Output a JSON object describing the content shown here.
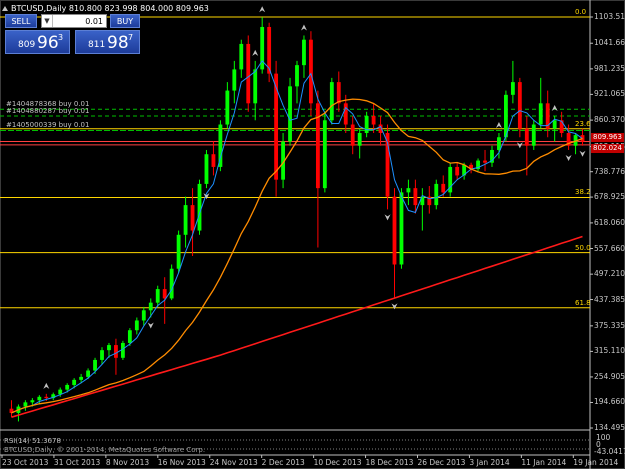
{
  "header": {
    "symbol_line": "BTCUSD,Daily  810.800 823.998 804.000 809.963"
  },
  "trade_panel": {
    "sell_label": "SELL",
    "buy_label": "BUY",
    "lot_value": "0.01",
    "sell_price_prefix": "809",
    "sell_price_big": "96",
    "sell_price_sup": "3",
    "buy_price_prefix": "811",
    "buy_price_big": "98",
    "buy_price_sup": "7"
  },
  "orders": [
    {
      "label": "#1404878368 buy 0.01",
      "price": 886
    },
    {
      "label": "#1404880287 buy 0.01",
      "price": 870
    },
    {
      "label": "#1405000339 buy 0.01",
      "price": 836
    }
  ],
  "price_axis": {
    "ticks": [
      "1103.510",
      "1041.665",
      "981.235",
      "921.065",
      "860.370",
      "798.115",
      "738.776",
      "678.925",
      "618.060",
      "557.660",
      "497.210",
      "437.385",
      "375.335",
      "315.110",
      "254.905",
      "194.660",
      "134.495"
    ],
    "current_bid": "809.963",
    "current_ask": "802.024",
    "sub_ticks": [
      "100",
      "0"
    ],
    "sub_bottom": "-43.0417"
  },
  "fib_levels": [
    {
      "label": "0.0",
      "price": 1103.5
    },
    {
      "label": "23.6",
      "price": 840
    },
    {
      "label": "38.2",
      "price": 678
    },
    {
      "label": "50.0",
      "price": 548
    },
    {
      "label": "61.8",
      "price": 418
    }
  ],
  "time_axis": {
    "labels": [
      "23 Oct 2013",
      "31 Oct 2013",
      "8 Nov 2013",
      "16 Nov 2013",
      "24 Nov 2013",
      "2 Dec 2013",
      "10 Dec 2013",
      "18 Dec 2013",
      "26 Dec 2013",
      "3 Jan 2014",
      "11 Jan 2014",
      "19 Jan 2014"
    ]
  },
  "subwindow": {
    "indicator_label": "RSI(14) 51.3678",
    "copyright": "BTCUSD,Daily, © 2001-2014, MetaQuotes Software Corp."
  },
  "colors": {
    "bull_candle": "#00ff00",
    "bear_candle": "#ff0000",
    "ma_fast": "#1e90ff",
    "ma_mid": "#ff8c00",
    "ma_slow": "#ff1a1a",
    "fib": "#ffd700",
    "order_line": "#00c000"
  },
  "chart_data": {
    "type": "candlestick",
    "timeframe": "Daily",
    "symbol": "BTCUSD",
    "ylim": [
      134.495,
      1103.51
    ],
    "candles": [
      {
        "o": 180,
        "h": 200,
        "l": 160,
        "c": 170
      },
      {
        "o": 170,
        "h": 190,
        "l": 150,
        "c": 185
      },
      {
        "o": 185,
        "h": 200,
        "l": 175,
        "c": 195
      },
      {
        "o": 195,
        "h": 205,
        "l": 185,
        "c": 200
      },
      {
        "o": 200,
        "h": 212,
        "l": 192,
        "c": 208
      },
      {
        "o": 208,
        "h": 215,
        "l": 198,
        "c": 205
      },
      {
        "o": 205,
        "h": 218,
        "l": 200,
        "c": 214
      },
      {
        "o": 214,
        "h": 230,
        "l": 208,
        "c": 225
      },
      {
        "o": 225,
        "h": 240,
        "l": 218,
        "c": 236
      },
      {
        "o": 236,
        "h": 252,
        "l": 228,
        "c": 248
      },
      {
        "o": 248,
        "h": 262,
        "l": 240,
        "c": 255
      },
      {
        "o": 255,
        "h": 275,
        "l": 250,
        "c": 270
      },
      {
        "o": 270,
        "h": 300,
        "l": 262,
        "c": 295
      },
      {
        "o": 295,
        "h": 325,
        "l": 285,
        "c": 318
      },
      {
        "o": 318,
        "h": 335,
        "l": 300,
        "c": 330
      },
      {
        "o": 330,
        "h": 345,
        "l": 260,
        "c": 300
      },
      {
        "o": 300,
        "h": 340,
        "l": 295,
        "c": 335
      },
      {
        "o": 335,
        "h": 370,
        "l": 328,
        "c": 365
      },
      {
        "o": 365,
        "h": 395,
        "l": 355,
        "c": 388
      },
      {
        "o": 388,
        "h": 420,
        "l": 376,
        "c": 412
      },
      {
        "o": 412,
        "h": 440,
        "l": 395,
        "c": 430
      },
      {
        "o": 430,
        "h": 470,
        "l": 420,
        "c": 462
      },
      {
        "o": 462,
        "h": 490,
        "l": 380,
        "c": 440
      },
      {
        "o": 440,
        "h": 520,
        "l": 436,
        "c": 510
      },
      {
        "o": 510,
        "h": 600,
        "l": 500,
        "c": 590
      },
      {
        "o": 590,
        "h": 680,
        "l": 560,
        "c": 660
      },
      {
        "o": 660,
        "h": 700,
        "l": 540,
        "c": 600
      },
      {
        "o": 600,
        "h": 720,
        "l": 590,
        "c": 710
      },
      {
        "o": 710,
        "h": 790,
        "l": 700,
        "c": 780
      },
      {
        "o": 780,
        "h": 810,
        "l": 730,
        "c": 750
      },
      {
        "o": 750,
        "h": 860,
        "l": 740,
        "c": 850
      },
      {
        "o": 850,
        "h": 950,
        "l": 840,
        "c": 930
      },
      {
        "o": 930,
        "h": 1000,
        "l": 900,
        "c": 980
      },
      {
        "o": 980,
        "h": 1050,
        "l": 960,
        "c": 1040
      },
      {
        "o": 1040,
        "h": 1060,
        "l": 880,
        "c": 900
      },
      {
        "o": 900,
        "h": 1000,
        "l": 860,
        "c": 980
      },
      {
        "o": 980,
        "h": 1103,
        "l": 970,
        "c": 1080
      },
      {
        "o": 1080,
        "h": 1090,
        "l": 950,
        "c": 970
      },
      {
        "o": 970,
        "h": 1000,
        "l": 680,
        "c": 720
      },
      {
        "o": 720,
        "h": 830,
        "l": 700,
        "c": 810
      },
      {
        "o": 810,
        "h": 960,
        "l": 800,
        "c": 940
      },
      {
        "o": 940,
        "h": 1000,
        "l": 900,
        "c": 990
      },
      {
        "o": 990,
        "h": 1060,
        "l": 960,
        "c": 1050
      },
      {
        "o": 1050,
        "h": 1070,
        "l": 870,
        "c": 900
      },
      {
        "o": 900,
        "h": 930,
        "l": 560,
        "c": 700
      },
      {
        "o": 700,
        "h": 880,
        "l": 690,
        "c": 860
      },
      {
        "o": 860,
        "h": 960,
        "l": 850,
        "c": 950
      },
      {
        "o": 950,
        "h": 975,
        "l": 880,
        "c": 900
      },
      {
        "o": 900,
        "h": 920,
        "l": 830,
        "c": 850
      },
      {
        "o": 850,
        "h": 870,
        "l": 780,
        "c": 800
      },
      {
        "o": 800,
        "h": 840,
        "l": 770,
        "c": 830
      },
      {
        "o": 830,
        "h": 880,
        "l": 820,
        "c": 870
      },
      {
        "o": 870,
        "h": 900,
        "l": 830,
        "c": 850
      },
      {
        "o": 850,
        "h": 870,
        "l": 800,
        "c": 830
      },
      {
        "o": 830,
        "h": 850,
        "l": 650,
        "c": 680
      },
      {
        "o": 680,
        "h": 700,
        "l": 440,
        "c": 520
      },
      {
        "o": 520,
        "h": 700,
        "l": 510,
        "c": 690
      },
      {
        "o": 690,
        "h": 720,
        "l": 660,
        "c": 700
      },
      {
        "o": 700,
        "h": 720,
        "l": 640,
        "c": 660
      },
      {
        "o": 660,
        "h": 700,
        "l": 600,
        "c": 680
      },
      {
        "o": 680,
        "h": 705,
        "l": 640,
        "c": 660
      },
      {
        "o": 660,
        "h": 720,
        "l": 650,
        "c": 710
      },
      {
        "o": 710,
        "h": 730,
        "l": 680,
        "c": 690
      },
      {
        "o": 690,
        "h": 760,
        "l": 680,
        "c": 750
      },
      {
        "o": 750,
        "h": 760,
        "l": 720,
        "c": 730
      },
      {
        "o": 730,
        "h": 760,
        "l": 720,
        "c": 755
      },
      {
        "o": 755,
        "h": 760,
        "l": 735,
        "c": 745
      },
      {
        "o": 745,
        "h": 770,
        "l": 740,
        "c": 765
      },
      {
        "o": 765,
        "h": 790,
        "l": 740,
        "c": 760
      },
      {
        "o": 760,
        "h": 800,
        "l": 750,
        "c": 790
      },
      {
        "o": 790,
        "h": 830,
        "l": 770,
        "c": 820
      },
      {
        "o": 820,
        "h": 930,
        "l": 810,
        "c": 920
      },
      {
        "o": 920,
        "h": 1000,
        "l": 900,
        "c": 950
      },
      {
        "o": 950,
        "h": 960,
        "l": 820,
        "c": 840
      },
      {
        "o": 840,
        "h": 870,
        "l": 730,
        "c": 800
      },
      {
        "o": 800,
        "h": 860,
        "l": 790,
        "c": 850
      },
      {
        "o": 850,
        "h": 960,
        "l": 840,
        "c": 900
      },
      {
        "o": 900,
        "h": 930,
        "l": 820,
        "c": 840
      },
      {
        "o": 840,
        "h": 870,
        "l": 810,
        "c": 860
      },
      {
        "o": 860,
        "h": 880,
        "l": 820,
        "c": 830
      },
      {
        "o": 830,
        "h": 850,
        "l": 790,
        "c": 800
      },
      {
        "o": 800,
        "h": 830,
        "l": 780,
        "c": 825
      },
      {
        "o": 825,
        "h": 840,
        "l": 800,
        "c": 810
      }
    ]
  }
}
